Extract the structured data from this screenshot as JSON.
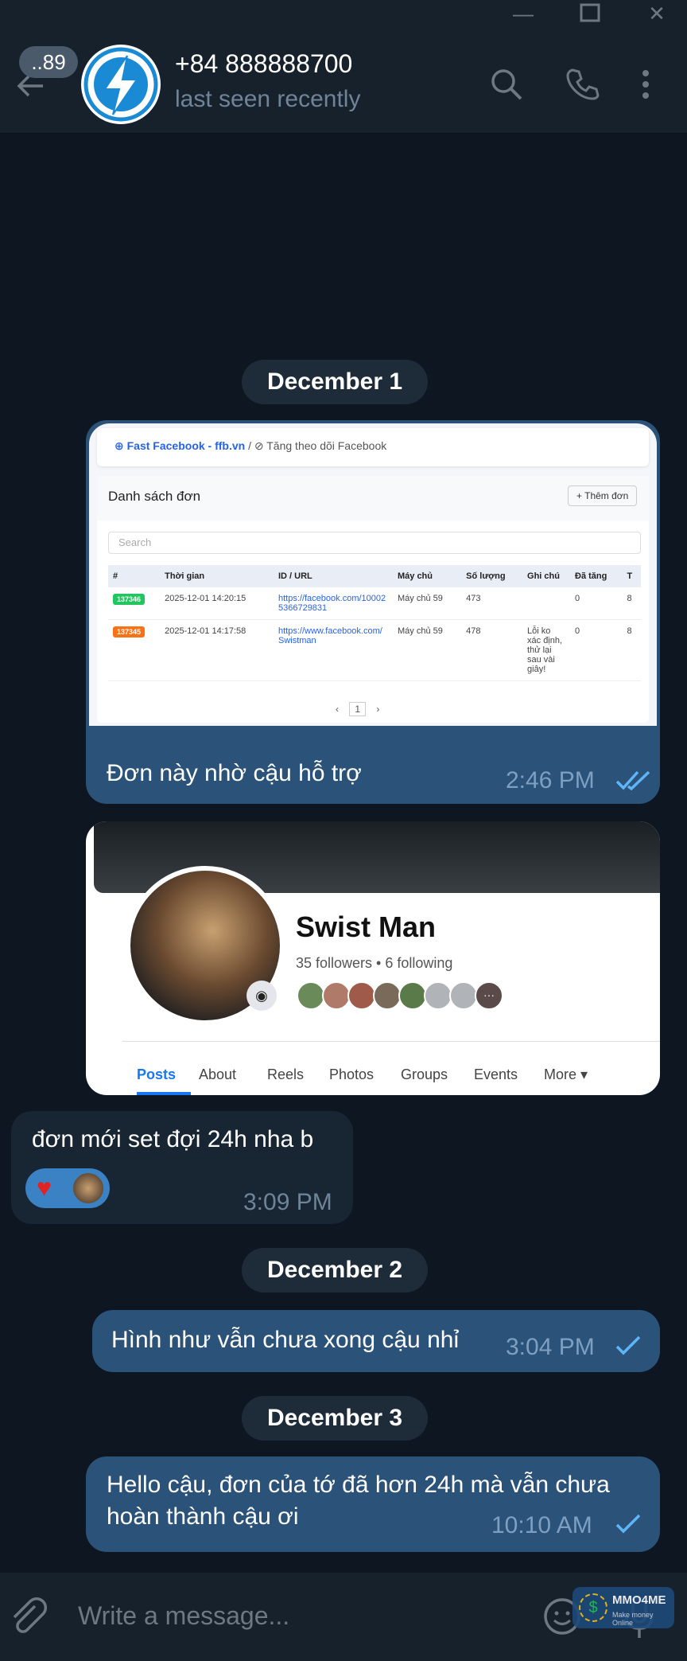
{
  "header": {
    "unread_count": "..89",
    "contact_name": "+84 888888700",
    "status": "last seen recently"
  },
  "dates": [
    "December 1",
    "December 2",
    "December 3"
  ],
  "screenshot1": {
    "site": "Fast Facebook - ffb.vn",
    "separator": "/",
    "page": "Tăng theo dõi Facebook",
    "heading": "Danh sách đơn",
    "add_button": "+ Thêm đơn",
    "search_placeholder": "Search",
    "columns": [
      "#",
      "Thời gian",
      "ID / URL",
      "Máy chủ",
      "Số lượng",
      "Ghi chú",
      "Đã tăng",
      "T"
    ],
    "rows": [
      {
        "id": "137346",
        "time": "2025-12-01 14:20:15",
        "url": "https://facebook.com/100025366729831",
        "server": "Máy chủ 59",
        "qty": "473",
        "note": "",
        "done": "0",
        "tail": "8"
      },
      {
        "id": "137345",
        "time": "2025-12-01 14:17:58",
        "url": "https://www.facebook.com/Swistman",
        "server": "Máy chủ 59",
        "qty": "478",
        "note": "Lỗi ko xác định, thử lại sau vài giây!",
        "done": "0",
        "tail": "8"
      }
    ],
    "page_num": "1"
  },
  "msg1": {
    "text": "Đơn này nhờ cậu hỗ trợ",
    "time": "2:46 PM"
  },
  "screenshot2": {
    "profile_name": "Swist Man",
    "followers": "35 followers • 6 following",
    "tabs": [
      "Posts",
      "About",
      "Reels",
      "Photos",
      "Groups",
      "Events",
      "More ▾"
    ]
  },
  "msg2": {
    "text": "đơn mới set đợi 24h nha b",
    "time": "3:09 PM"
  },
  "msg3": {
    "text": "Hình như vẫn chưa xong cậu nhỉ",
    "time": "3:04 PM"
  },
  "msg4": {
    "line1": "Hello cậu, đơn của tớ đã hơn 24h mà vẫn chưa",
    "line2": "hoàn thành cậu ơi",
    "time": "10:10 AM"
  },
  "input": {
    "placeholder": "Write a message..."
  },
  "watermark": {
    "brand": "MMO4ME",
    "tagline": "Make money Online"
  },
  "colors": {
    "background": "#0e1621",
    "header": "#17212b",
    "outgoing": "#2b5278",
    "incoming": "#182533",
    "accent": "#5eb5f7"
  }
}
